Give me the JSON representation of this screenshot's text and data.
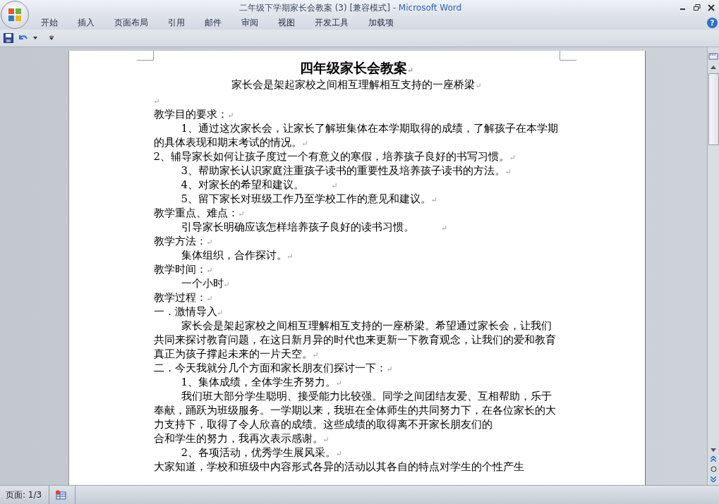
{
  "window": {
    "document_title": "二年级下学期家长会教案 (3) [兼容模式]",
    "app_title": "- Microsoft Word"
  },
  "ribbon_tabs": [
    {
      "label": "开始",
      "selected": false
    },
    {
      "label": "插入",
      "selected": false
    },
    {
      "label": "页面布局",
      "selected": false
    },
    {
      "label": "引用",
      "selected": false
    },
    {
      "label": "邮件",
      "selected": false
    },
    {
      "label": "审阅",
      "selected": false
    },
    {
      "label": "视图",
      "selected": false
    },
    {
      "label": "开发工具",
      "selected": false
    },
    {
      "label": "加载项",
      "selected": false
    }
  ],
  "document": {
    "paragraphs": [
      {
        "kind": "title",
        "text": "四年级家长会教案",
        "mark": "↵"
      },
      {
        "kind": "subtitle",
        "text": "家长会是架起家校之间相互理解相互支持的一座桥梁",
        "mark": "↵"
      },
      {
        "kind": "body",
        "indent": false,
        "mark": "↵"
      },
      {
        "kind": "body",
        "indent": false,
        "text": "教学目的要求：",
        "mark": "↵"
      },
      {
        "kind": "body",
        "indent": true,
        "text": "1、通过这次家长会，让家长了解班集体在本学期取得的成绩，了解孩子在本学期的具体表现和期末考试的情况。",
        "mark": "↵"
      },
      {
        "kind": "body",
        "indent": false,
        "text": "2、辅导家长如何让孩子度过一个有意义的寒假，培养孩子良好的书写习惯。",
        "mark": "↵"
      },
      {
        "kind": "body",
        "indent": true,
        "text": "3、帮助家长认识家庭注重孩子读书的重要性及培养孩子读书的方法。",
        "mark": "↵"
      },
      {
        "kind": "body",
        "indent": true,
        "spaced": true,
        "text": "4、对家长的希望和建议。",
        "mark": "↵"
      },
      {
        "kind": "body",
        "indent": true,
        "text": "5、留下家长对班级工作乃至学校工作的意见和建议。",
        "mark": "↵"
      },
      {
        "kind": "body",
        "indent": false,
        "text": "教学重点、难点：",
        "mark": "↵"
      },
      {
        "kind": "body",
        "indent": true,
        "spaced": true,
        "text": "引导家长明确应该怎样培养孩子良好的读书习惯。",
        "mark": "↵"
      },
      {
        "kind": "body",
        "indent": false,
        "text": "教学方法：",
        "mark": "↵"
      },
      {
        "kind": "body",
        "indent": true,
        "text": "集体组织，合作探讨。",
        "mark": "↵"
      },
      {
        "kind": "body",
        "indent": false,
        "text": "教学时间：",
        "mark": "↵"
      },
      {
        "kind": "body",
        "indent": true,
        "text": "一个小时",
        "mark": "↵"
      },
      {
        "kind": "body",
        "indent": false,
        "text": "教学过程：",
        "mark": "↵"
      },
      {
        "kind": "body",
        "indent": false,
        "text": "一．激情导入",
        "mark": "↵"
      },
      {
        "kind": "body",
        "indent": true,
        "text": "家长会是架起家校之间相互理解相互支持的一座桥梁。希望通过家长会，让我们共同来探讨教育问题，在这日新月异的时代也来更新一下教育观念，让我们的爱和教育真正为孩子撑起未来的一片天空。",
        "mark": "↵"
      },
      {
        "kind": "body",
        "indent": false,
        "text": "二．今天我就分几个方面和家长朋友们探讨一下：",
        "mark": "↵"
      },
      {
        "kind": "body",
        "indent": true,
        "text": "1、集体成绩，全体学生齐努力。",
        "mark": "↵"
      },
      {
        "kind": "body",
        "indent": true,
        "text": "我们班大部分学生聪明、接受能力比较强。同学之间团结友爱、互相帮助，乐于奉献，踊跃为班级服务。一学期以来，我班在全体师生的共同努力下，在各位家长的大力支持下，取得了令人欣喜的成绩。这些成绩的取得离不开家长朋友们的"
      },
      {
        "kind": "body",
        "indent": false,
        "text": "合和学生的努力，我再次表示感谢。",
        "mark": "↵"
      },
      {
        "kind": "body",
        "indent": true,
        "text": "2、各项活动，优秀学生展风采。",
        "mark": "↵"
      },
      {
        "kind": "body",
        "indent": false,
        "text": "大家知道，学校和班级中内容形式各异的活动以其各自的特点对学生的个性产生"
      }
    ]
  },
  "help": "?",
  "status_bar": {
    "page": "页面: 1/3"
  }
}
